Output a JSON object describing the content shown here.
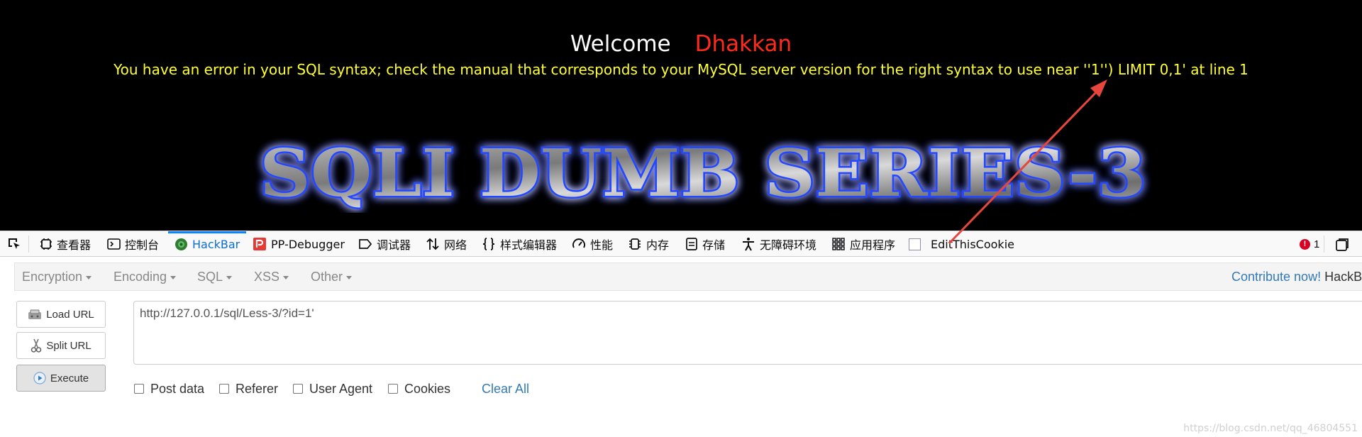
{
  "page": {
    "welcome_label": "Welcome",
    "user_name": "Dhakkan",
    "error_message": "You have an error in your SQL syntax; check the manual that corresponds to your MySQL server version for the right syntax to use near ''1'') LIMIT 0,1' at line 1",
    "banner_title": "SQLI DUMB SERIES-3"
  },
  "devtools": {
    "tabs": [
      {
        "label": "查看器",
        "icon": "inspector-icon"
      },
      {
        "label": "控制台",
        "icon": "console-icon"
      },
      {
        "label": "HackBar",
        "icon": "hackbar-icon",
        "active": true
      },
      {
        "label": "PP-Debugger",
        "icon": "pp-debugger-icon"
      },
      {
        "label": "调试器",
        "icon": "debugger-icon"
      },
      {
        "label": "网络",
        "icon": "network-icon"
      },
      {
        "label": "样式编辑器",
        "icon": "style-editor-icon"
      },
      {
        "label": "性能",
        "icon": "performance-icon"
      },
      {
        "label": "内存",
        "icon": "memory-icon"
      },
      {
        "label": "存储",
        "icon": "storage-icon"
      },
      {
        "label": "无障碍环境",
        "icon": "accessibility-icon"
      },
      {
        "label": "应用程序",
        "icon": "application-icon"
      },
      {
        "label": "EditThisCookie",
        "icon": "checkbox-icon"
      }
    ],
    "error_count": "1"
  },
  "hackbar": {
    "menu": [
      "Encryption",
      "Encoding",
      "SQL",
      "XSS",
      "Other"
    ],
    "contribute_link": "Contribute now!",
    "contribute_rest": "HackB",
    "buttons": {
      "load": "Load URL",
      "split": "Split URL",
      "execute": "Execute"
    },
    "url_value": "http://127.0.0.1/sql/Less-3/?id=1'",
    "options": [
      "Post data",
      "Referer",
      "User Agent",
      "Cookies"
    ],
    "clear_all": "Clear All"
  },
  "watermark": "https://blog.csdn.net/qq_46804551",
  "colors": {
    "accent": "#0a84ff",
    "error_text": "#ffff33",
    "user_name": "#ff2a1a",
    "annotation_arrow": "#e8453c"
  }
}
